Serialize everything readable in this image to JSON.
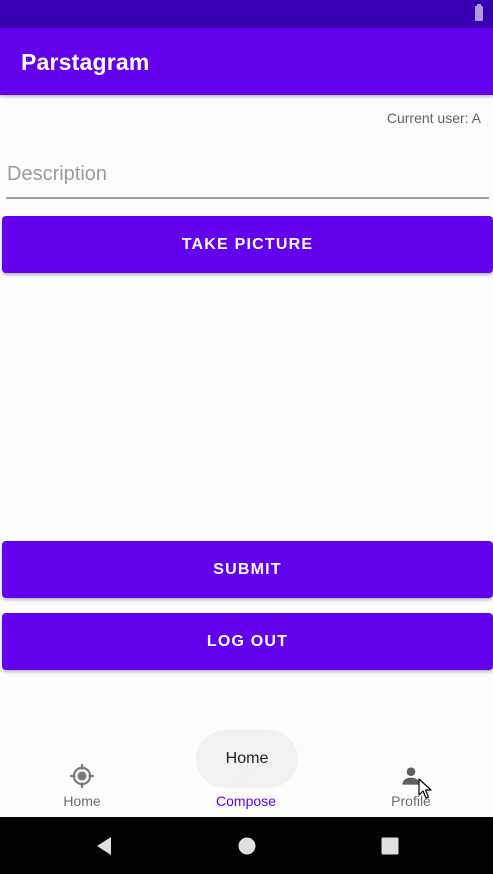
{
  "status_bar": {
    "battery_icon": "battery-icon"
  },
  "app_bar": {
    "title": "Parstagram"
  },
  "compose": {
    "current_user": "Current user: A",
    "description": {
      "value": "",
      "placeholder": "Description"
    },
    "take_picture_label": "TAKE PICTURE",
    "submit_label": "SUBMIT",
    "logout_label": "LOG OUT"
  },
  "bottom_nav": {
    "items": [
      {
        "label": "Home",
        "icon": "home-crosshair-icon",
        "selected": false
      },
      {
        "label": "Compose",
        "icon": "compose-pen-icon",
        "selected": true
      },
      {
        "label": "Profile",
        "icon": "person-icon",
        "selected": false
      }
    ],
    "tooltip": "Home"
  },
  "colors": {
    "primary": "#6200ee",
    "primary_dark": "#3700b3",
    "on_primary": "#ffffff",
    "inactive_nav": "#6b6b6b"
  },
  "system_nav": {
    "back": "back-triangle-icon",
    "home": "home-circle-icon",
    "recents": "recents-square-icon"
  }
}
